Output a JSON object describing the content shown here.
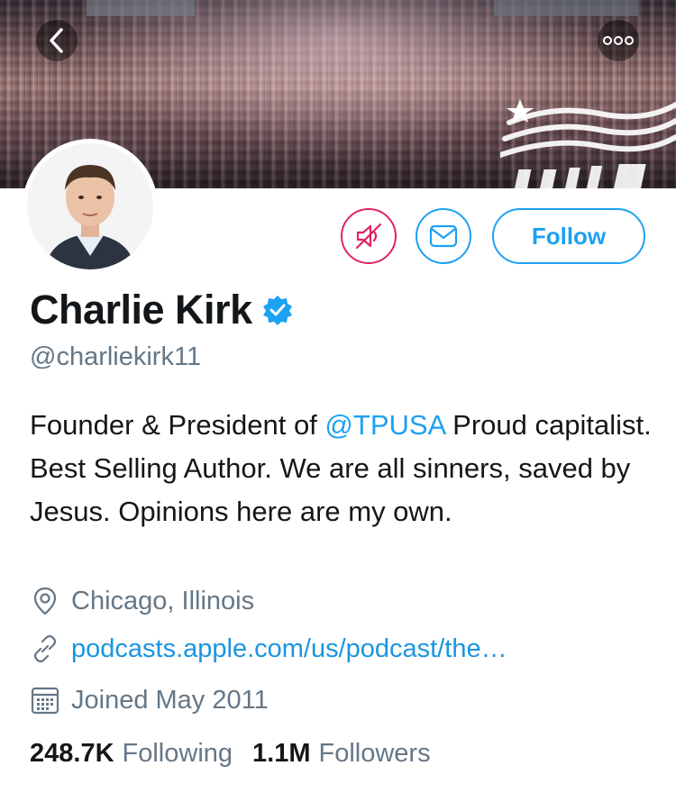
{
  "profile": {
    "name": "Charlie Kirk",
    "handle": "@charliekirk11",
    "verified": true,
    "bio_prefix": "Founder & President of ",
    "bio_mention": "@TPUSA",
    "bio_suffix": " Proud capitalist. Best Selling Author. We are all sinners, saved by Jesus. Opinions here are my own.",
    "location": "Chicago, Illinois",
    "website": "podcasts.apple.com/us/podcast/the…",
    "joined": "Joined May 2011"
  },
  "actions": {
    "follow_label": "Follow",
    "mute_icon": "muted-speaker-icon",
    "message_icon": "envelope-icon"
  },
  "stats": {
    "following_count": "248.7K",
    "following_label": "Following",
    "followers_count": "1.1M",
    "followers_label": "Followers"
  },
  "nav": {
    "back_icon": "chevron-left-icon",
    "more_icon": "ellipsis-icon"
  },
  "colors": {
    "accent": "#1da1f2",
    "mute": "#e0245e",
    "secondary_text": "#657786",
    "primary_text": "#14171a"
  }
}
